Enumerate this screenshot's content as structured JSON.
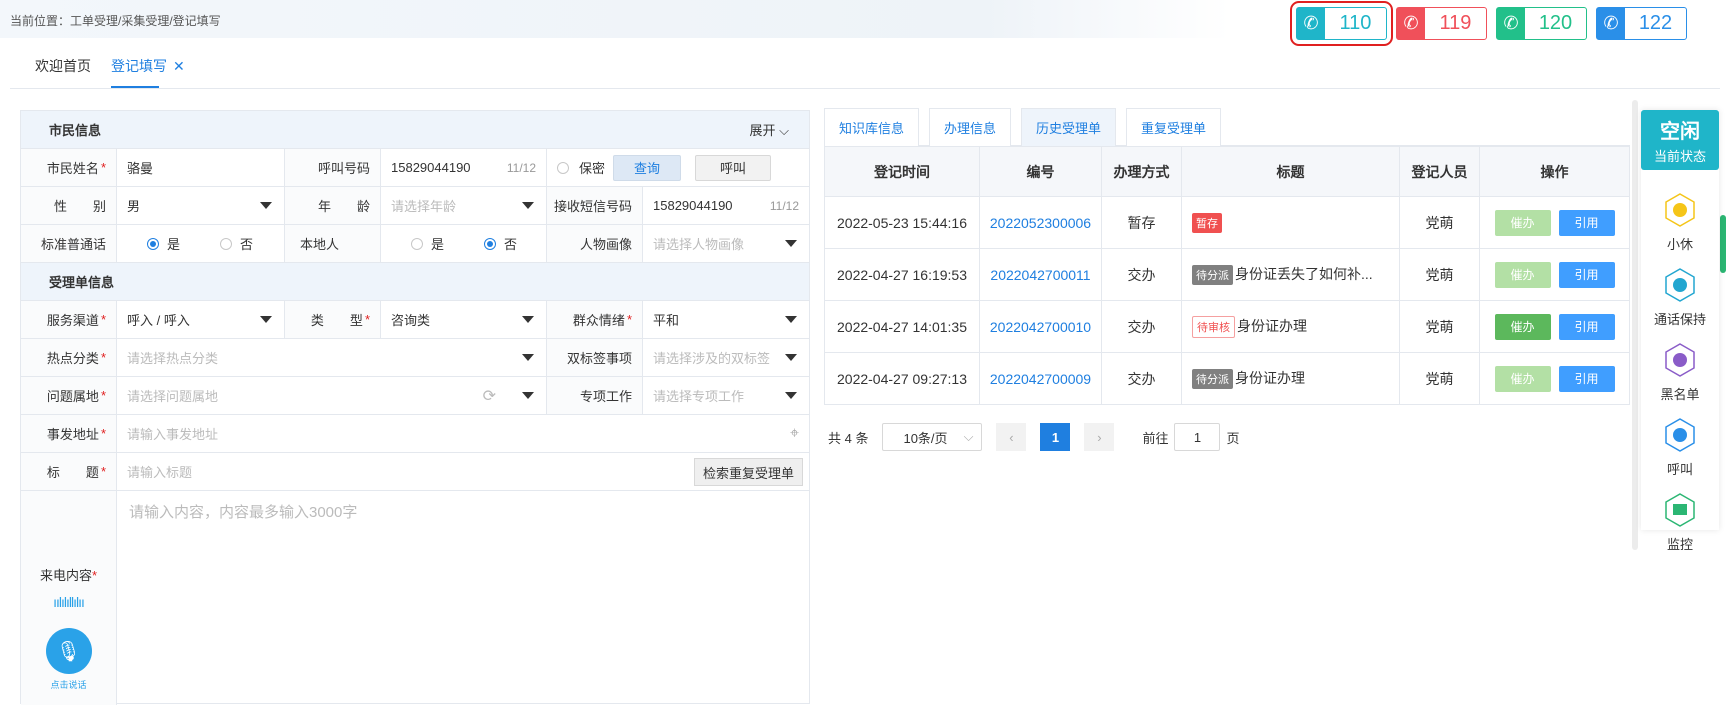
{
  "breadcrumb": "当前位置：工单受理/采集受理/登记填写",
  "tabs": [
    {
      "label": "欢迎首页"
    },
    {
      "label": "登记填写",
      "close": "✕"
    }
  ],
  "hotlines": [
    {
      "num": "110",
      "color": "#1fb5c9"
    },
    {
      "num": "119",
      "color": "#f0505a"
    },
    {
      "num": "120",
      "color": "#22c08a"
    },
    {
      "num": "122",
      "color": "#2a8fe8"
    }
  ],
  "citizen": {
    "section": "市民信息",
    "expand": "展开",
    "name_label": "市民姓名",
    "name": "骆曼",
    "call_label": "呼叫号码",
    "call": "15829044190",
    "call_count": "11/12",
    "secret_label": "保密",
    "query_btn": "查询",
    "call_btn": "呼叫",
    "gender_label": "性　　别",
    "gender": "男",
    "age_label": "年　　龄",
    "age_ph": "请选择年龄",
    "sms_label": "接收短信号码",
    "sms": "15829044190",
    "sms_count": "11/12",
    "mandarin_label": "标准普通话",
    "yes": "是",
    "no": "否",
    "local_label": "本地人",
    "portrait_label": "人物画像",
    "portrait_ph": "请选择人物画像"
  },
  "ticket": {
    "section": "受理单信息",
    "channel_label": "服务渠道",
    "channel": "呼入 / 呼入",
    "type_label": "类　　型",
    "type": "咨询类",
    "mood_label": "群众情绪",
    "mood": "平和",
    "hot_label": "热点分类",
    "hot_ph": "请选择热点分类",
    "dual_label": "双标签事项",
    "dual_ph": "请选择涉及的双标签",
    "area_label": "问题属地",
    "area_ph": "请选择问题属地",
    "special_label": "专项工作",
    "special_ph": "请选择专项工作",
    "addr_label": "事发地址",
    "addr_ph": "请输入事发地址",
    "title_label": "标　　题",
    "title_ph": "请输入标题",
    "dup_btn": "检索重复受理单",
    "content_label": "来电内容",
    "content_ph": "请输入内容，内容最多输入3000字",
    "mic_caption": "点击说话"
  },
  "right_tabs": [
    {
      "label": "知识库信息"
    },
    {
      "label": "办理信息"
    },
    {
      "label": "历史受理单"
    },
    {
      "label": "重复受理单"
    }
  ],
  "table": {
    "headers": [
      "登记时间",
      "编号",
      "办理方式",
      "标题",
      "登记人员",
      "操作"
    ],
    "rows": [
      {
        "time": "2022-05-23 15:44:16",
        "id": "2022052300006",
        "mode": "暂存",
        "badge": "暂存",
        "title": "",
        "person": "党萌"
      },
      {
        "time": "2022-04-27 16:19:53",
        "id": "2022042700011",
        "mode": "交办",
        "badge": "待分派",
        "title": "身份证丢失了如何补...",
        "person": "党萌"
      },
      {
        "time": "2022-04-27 14:01:35",
        "id": "2022042700010",
        "mode": "交办",
        "badge": "待审核",
        "title": "身份证办理",
        "person": "党萌"
      },
      {
        "time": "2022-04-27 09:27:13",
        "id": "2022042700009",
        "mode": "交办",
        "badge": "待分派",
        "title": "身份证办理",
        "person": "党萌"
      }
    ],
    "urge": "催办",
    "cite": "引用"
  },
  "pager": {
    "total": "共 4 条",
    "size": "10条/页",
    "current": "1",
    "goto_pre": "前往",
    "goto_val": "1",
    "goto_post": "页"
  },
  "side": {
    "status_main": "空闲",
    "status_sub": "当前状态",
    "items": [
      {
        "label": "小休"
      },
      {
        "label": "通话保持"
      },
      {
        "label": "黑名单"
      },
      {
        "label": "呼叫"
      },
      {
        "label": "监控"
      }
    ]
  }
}
